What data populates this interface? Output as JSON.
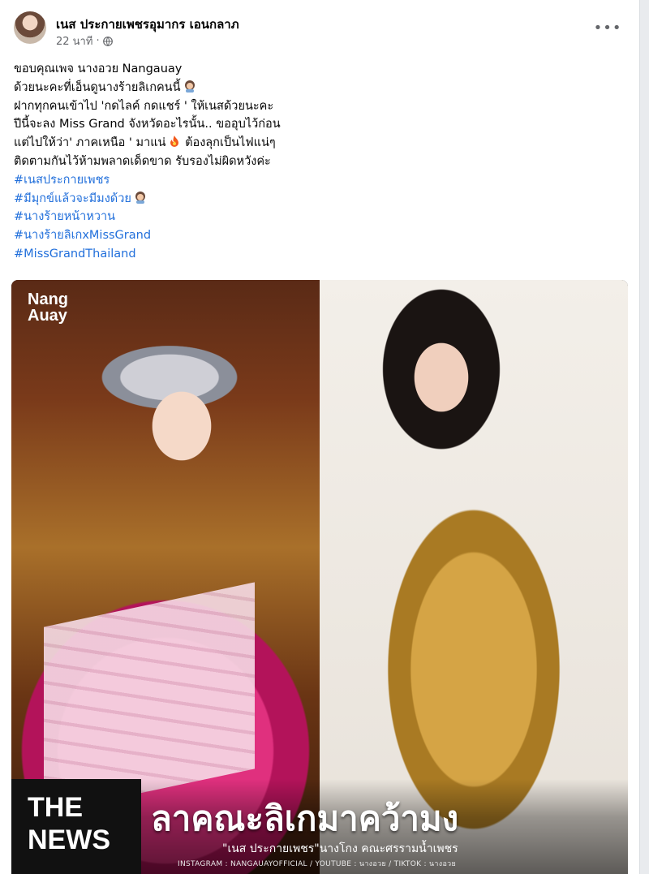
{
  "post": {
    "author": "เนส ประกายเพชรอุมากร เอนกลาภ",
    "time": "22 นาที",
    "separator": "·",
    "privacy_icon": "globe-icon",
    "more_icon": "more-icon",
    "more_label": "•••"
  },
  "body": {
    "lines": [
      "ขอบคุณเพจ นางอวย Nangauay",
      "ด้วยนะคะที่เอ็นดูนางร้ายลิเกคนนี้",
      "ฝากทุกคนเข้าไป 'กดไลค์ กดแชร์ ' ให้เนสด้วยนะคะ",
      "ปีนี้จะลง Miss Grand จังหวัดอะไรนั้น.. ขออุบไว้ก่อน",
      "แต่ไปให้ว่า' ภาคเหนือ ' มาแน่",
      "ต้องลุกเป็นไฟแน่ๆ",
      "ติดตามกันไว้ห้ามพลาดเด็ดขาด รับรองไม่ผิดหวังค่ะ"
    ],
    "hashtags": [
      "#เนสประกายเพชร",
      "#มีมุกข์แล้วจะมีมงด้วย",
      "#นางร้ายหน้าหวาน",
      "#นางร้ายลิเกxMissGrand",
      "#MissGrandThailand"
    ]
  },
  "media": {
    "watermark_line1": "Nang",
    "watermark_line2": "Auay",
    "the": "THE",
    "news": "NEWS",
    "headline": "ลาคณะลิเกมาคว้ามง",
    "subline": "\"เนส ประกายเพชร\"นางโกง คณะศรรามน้ำเพชร",
    "social": "INSTAGRAM : NANGAUAYOFFICIAL / YOUTUBE : นางอวย / TIKTOK : นางอวย"
  }
}
